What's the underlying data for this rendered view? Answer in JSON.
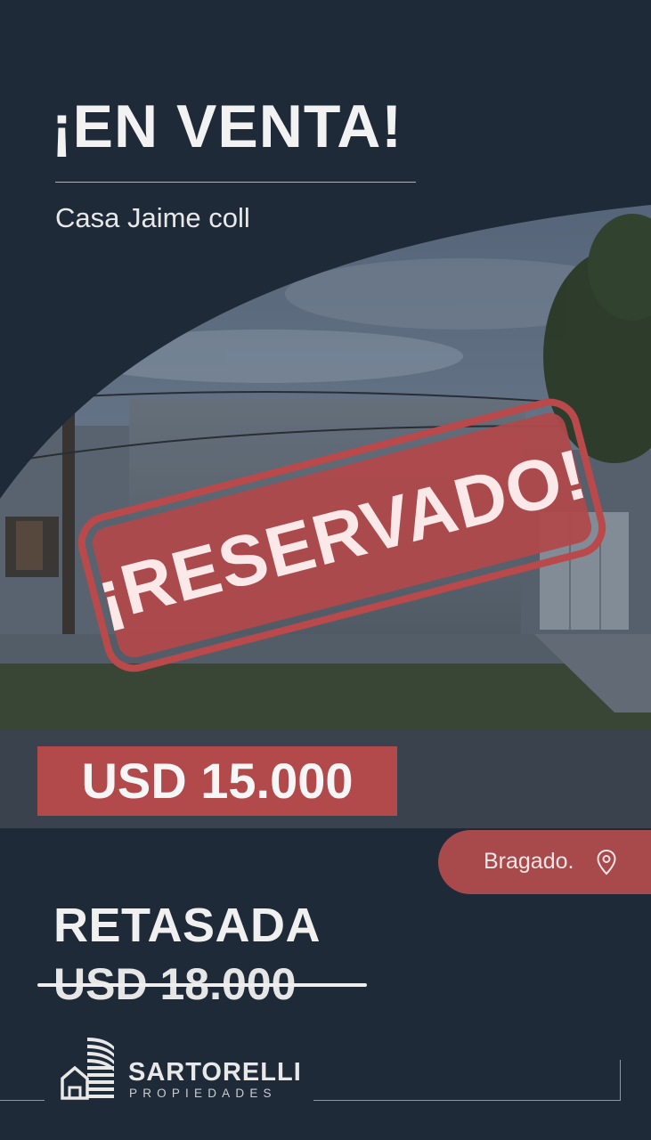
{
  "header": {
    "headline": "¡EN VENTA!",
    "subtitle": "Casa Jaime coll"
  },
  "stamp": {
    "text": "¡RESERVADO!",
    "color": "#b24a4c"
  },
  "price": {
    "current": "USD 15.000"
  },
  "location": {
    "city": "Bragado.",
    "icon": "map-pin-icon"
  },
  "retasada": {
    "label": "RETASADA",
    "old_price": "USD 18.000"
  },
  "brand": {
    "name": "SARTORELLI",
    "sub": "PROPIEDADES",
    "icon": "building-logo-icon"
  },
  "colors": {
    "background": "#1f2a38",
    "accent": "#b24a4c",
    "text": "#f2f2f2"
  }
}
